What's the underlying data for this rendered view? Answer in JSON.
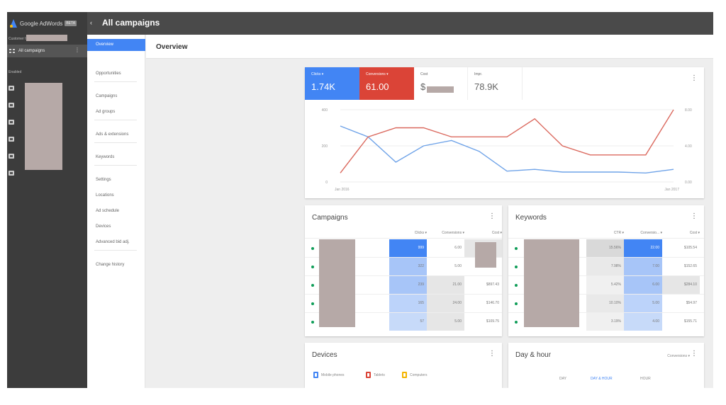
{
  "app": {
    "brand": "Google AdWords",
    "beta_badge": "BETA",
    "collapse_arrow": "‹",
    "page_heading": "All campaigns"
  },
  "left_sidebar": {
    "customer_label": "Customer ID",
    "all_campaigns_label": "All campaigns",
    "menu_glyph": "⋮",
    "enabled_label": "Enabled",
    "campaign_count": 6
  },
  "nav": {
    "active": "Overview",
    "groups": [
      [
        "Opportunities"
      ],
      [
        "Campaigns",
        "Ad groups"
      ],
      [
        "Ads & extensions"
      ],
      [
        "Keywords"
      ],
      [
        "Settings",
        "Locations",
        "Ad schedule",
        "Devices",
        "Advanced bid adj."
      ],
      [
        "Change history"
      ]
    ]
  },
  "main": {
    "title": "Overview"
  },
  "overview_card": {
    "menu_glyph": "⋮",
    "metrics": [
      {
        "label": "Clicks ▾",
        "value": "1.74K"
      },
      {
        "label": "Conversions ▾",
        "value": "61.00"
      },
      {
        "label": "Cost",
        "value": "$"
      },
      {
        "label": "Impr.",
        "value": "78.9K"
      }
    ]
  },
  "chart_data": {
    "type": "line",
    "xlabel": "",
    "ylabel": "",
    "x_tick_labels": [
      "Jan 2016",
      "Jan 2017"
    ],
    "y_left_ticks": [
      "400",
      "200",
      "0"
    ],
    "y_left_range": [
      0,
      400
    ],
    "y_right_ticks": [
      "8.00",
      "4.00",
      "0.00"
    ],
    "y_right_range": [
      0,
      8
    ],
    "grid": true,
    "series": [
      {
        "axis": "left",
        "color": "#6fa3e8",
        "values": [
          310,
          250,
          110,
          200,
          230,
          170,
          60,
          70,
          55,
          55,
          55,
          50,
          70
        ]
      },
      {
        "axis": "right",
        "color": "#db6a5f",
        "values": [
          1.0,
          5.0,
          6.0,
          6.0,
          5.0,
          5.0,
          5.0,
          7.0,
          4.0,
          3.0,
          3.0,
          3.0,
          8.0
        ]
      }
    ]
  },
  "campaigns_card": {
    "title": "Campaigns",
    "menu_glyph": "⋮",
    "columns": [
      "Clicks ▾",
      "Conversions ▾",
      "Cost ▾"
    ],
    "rows": [
      [
        "999",
        "6.00",
        ""
      ],
      [
        "322",
        "5.00",
        ""
      ],
      [
        "239",
        "21.00",
        "$897.43"
      ],
      [
        "165",
        "24.00",
        "$146.70"
      ],
      [
        "57",
        "5.00",
        "$109.75"
      ]
    ]
  },
  "keywords_card": {
    "title": "Keywords",
    "menu_glyph": "⋮",
    "columns": [
      "CTR ▾",
      "Conversio... ▾",
      "Cost ▾"
    ],
    "rows": [
      [
        "15.56%",
        "22.00",
        "$105.54"
      ],
      [
        "7.98%",
        "7.00",
        "$152.65"
      ],
      [
        "5.42%",
        "6.00",
        "$284.10"
      ],
      [
        "10.10%",
        "5.00",
        "$54.97"
      ],
      [
        "3.19%",
        "4.00",
        "$155.71"
      ]
    ]
  },
  "devices_card": {
    "title": "Devices",
    "menu_glyph": "⋮",
    "legend": [
      {
        "label": "Mobile phones",
        "color": "#4285f4"
      },
      {
        "label": "Tablets",
        "color": "#db4437"
      },
      {
        "label": "Computers",
        "color": "#f4b400"
      }
    ]
  },
  "dayhour_card": {
    "title": "Day & hour",
    "menu_glyph": "⋮",
    "dropdown": "Conversions ▾",
    "tabs": [
      "DAY",
      "DAY & HOUR",
      "HOUR"
    ],
    "active_tab": "DAY & HOUR"
  }
}
